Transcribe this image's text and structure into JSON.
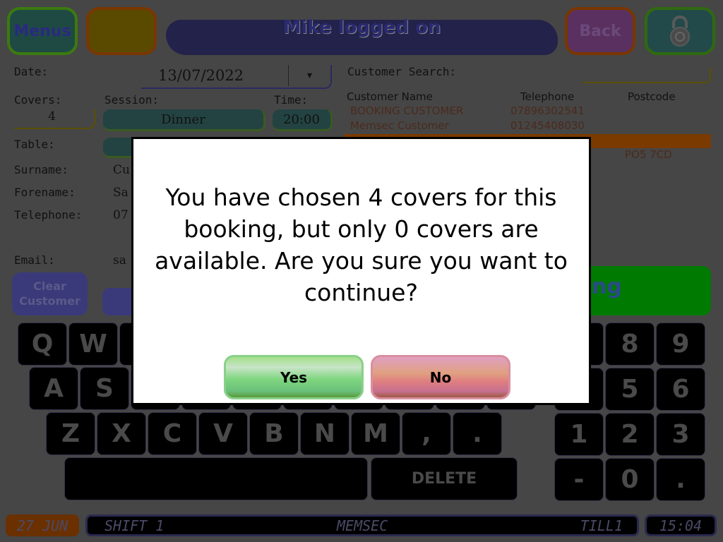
{
  "header": {
    "menus_label": "Menus",
    "title": "Mike logged on",
    "back_label": "Back",
    "lock_icon": "padlock-icon"
  },
  "form": {
    "date_label": "Date:",
    "date_value": "13/07/2022",
    "dropdown_icon": "▾",
    "covers_label": "Covers:",
    "covers_value": "4",
    "session_label": "Session:",
    "session_value": "Dinner",
    "time_label": "Time:",
    "time_value": "20:00",
    "table_label": "Table:",
    "surname_label": "Surname:",
    "surname_value": "Cu",
    "forename_label": "Forename:",
    "forename_value": "Sa",
    "telephone_label": "Telephone:",
    "telephone_value": "07",
    "email_label": "Email:",
    "email_value": "sa",
    "clear_customer_label": "Clear Customer"
  },
  "search": {
    "label": "Customer Search:",
    "columns": [
      "Customer Name",
      "Telephone",
      "Postcode"
    ],
    "rows": [
      {
        "name": "BOOKING CUSTOMER",
        "telephone": "07896302541",
        "postcode": ""
      },
      {
        "name": "Memsec Customer",
        "telephone": "01245408030",
        "postcode": ""
      },
      {
        "name": "",
        "telephone": "",
        "postcode": ""
      },
      {
        "name": "",
        "telephone": "",
        "postcode": "PO5 7CD"
      }
    ]
  },
  "action_button_visible_text": "ng",
  "keyboard": {
    "row1": [
      "Q",
      "W",
      "",
      "",
      "",
      "",
      "",
      "",
      "",
      ""
    ],
    "row2": [
      "A",
      "S",
      "",
      "",
      "",
      "",
      "",
      "",
      "",
      ""
    ],
    "row3": [
      "Z",
      "X",
      "C",
      "V",
      "B",
      "N",
      "M",
      ",",
      "."
    ],
    "delete": "DELETE",
    "numpad": [
      [
        "",
        "8",
        "9"
      ],
      [
        "",
        "5",
        "6"
      ],
      [
        "1",
        "2",
        "3"
      ],
      [
        "-",
        "0",
        "."
      ]
    ]
  },
  "status": {
    "date": "27 JUN",
    "shift": "SHIFT 1",
    "company": "MEMSEC",
    "till": "TILL1",
    "time": "15:04"
  },
  "dialog": {
    "message": "You have chosen 4 covers for this booking, but only 0 covers are available. Are you sure you want to continue?",
    "yes_label": "Yes",
    "no_label": "No"
  },
  "colors": {
    "background": "#464646",
    "yes": "#7fd67f",
    "no": "#d97f94",
    "selected_row": "#7a3a00",
    "action_green": "#007a00"
  }
}
